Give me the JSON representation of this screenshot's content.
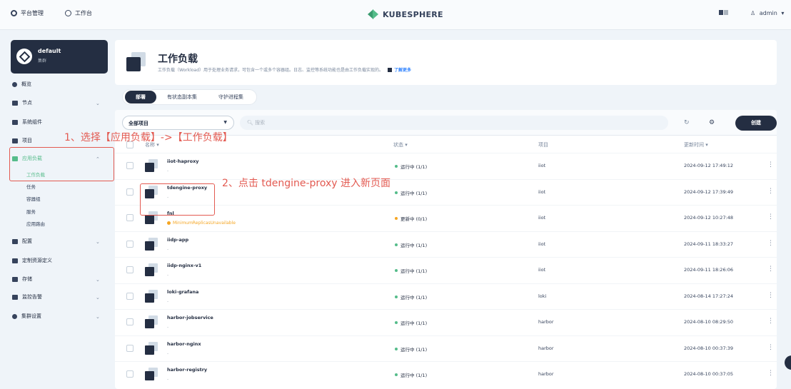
{
  "topbar": {
    "platform_label": "平台管理",
    "workbench_label": "工作台",
    "brand": "KUBESPHERE",
    "user": "admin"
  },
  "cluster": {
    "name": "default",
    "type": "集群"
  },
  "sidebar": {
    "items": [
      {
        "label": "概览"
      },
      {
        "label": "节点"
      },
      {
        "label": "系统组件"
      },
      {
        "label": "项目"
      },
      {
        "label": "应用负载"
      },
      {
        "label": "配置"
      },
      {
        "label": "定制资源定义"
      },
      {
        "label": "存储"
      },
      {
        "label": "监控告警"
      },
      {
        "label": "集群设置"
      }
    ],
    "app_workload_sub": [
      "工作负载",
      "任务",
      "容器组",
      "服务",
      "应用路由"
    ]
  },
  "header": {
    "title": "工作负载",
    "description": "工作负载（Workload）用于处理业务请求，可包含一个或多个容器组。日志、监控等系统功能也是由工作负载实现的。",
    "learn_more": "了解更多"
  },
  "tabs": [
    "部署",
    "有状态副本集",
    "守护进程集"
  ],
  "toolbar": {
    "project_select": "全部项目",
    "search_placeholder": "搜索",
    "create": "创建"
  },
  "table": {
    "columns": [
      "名称",
      "状态",
      "项目",
      "更新时间"
    ],
    "rows": [
      {
        "name": "iiot-haproxy",
        "sub": "-",
        "status": "运行中 (1/1)",
        "project": "iiot",
        "updated": "2024-09-12 17:49:12"
      },
      {
        "name": "tdengine-proxy",
        "sub": "-",
        "status": "运行中 (1/1)",
        "project": "iiot",
        "updated": "2024-09-12 17:39:49"
      },
      {
        "name": "fnl",
        "sub": "MinimumReplicasUnavailable",
        "status": "更新中 (0/1)",
        "project": "iiot",
        "updated": "2024-09-12 10:27:48"
      },
      {
        "name": "iidp-app",
        "sub": "-",
        "status": "运行中 (1/1)",
        "project": "iiot",
        "updated": "2024-09-11 18:33:27"
      },
      {
        "name": "iidp-nginx-v1",
        "sub": "-",
        "status": "运行中 (1/1)",
        "project": "iiot",
        "updated": "2024-09-11 18:26:06"
      },
      {
        "name": "loki-grafana",
        "sub": "-",
        "status": "运行中 (1/1)",
        "project": "loki",
        "updated": "2024-08-14 17:27:24"
      },
      {
        "name": "harbor-jobservice",
        "sub": "-",
        "status": "运行中 (1/1)",
        "project": "harbor",
        "updated": "2024-08-10 08:29:50"
      },
      {
        "name": "harbor-nginx",
        "sub": "-",
        "status": "运行中 (1/1)",
        "project": "harbor",
        "updated": "2024-08-10 00:37:39"
      },
      {
        "name": "harbor-registry",
        "sub": "-",
        "status": "运行中 (1/1)",
        "project": "harbor",
        "updated": "2024-08-10 00:37:05"
      }
    ]
  },
  "annotations": {
    "step1": "1、选择【应用负载】->【工作负载】",
    "step2": "2、点击 tdengine-proxy 进入新页面"
  },
  "colors": {
    "running": "#55bc8a",
    "updating": "#f5a623",
    "annotation": "#e35a51"
  }
}
